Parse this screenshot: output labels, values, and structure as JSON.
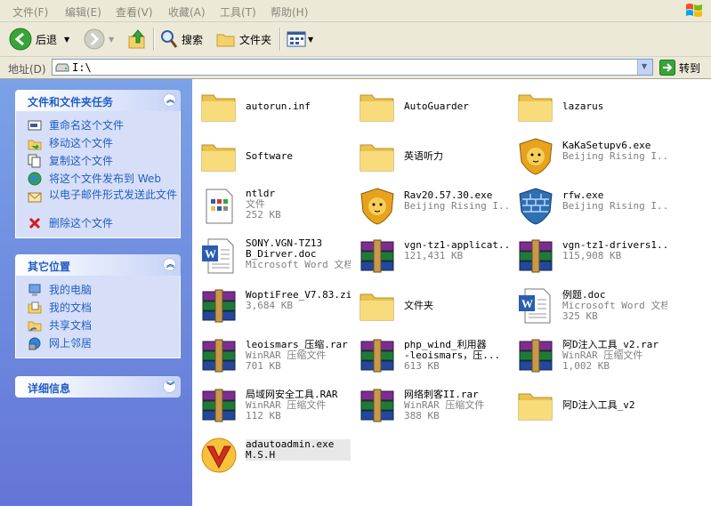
{
  "menu": [
    "文件(F)",
    "编辑(E)",
    "查看(V)",
    "收藏(A)",
    "工具(T)",
    "帮助(H)"
  ],
  "toolbar": {
    "back": "后退",
    "search": "搜索",
    "folders": "文件夹"
  },
  "address": {
    "label": "地址(D)",
    "path": "I:\\",
    "go": "转到"
  },
  "tasks": {
    "file_tasks": {
      "title": "文件和文件夹任务",
      "items": [
        "重命名这个文件",
        "移动这个文件",
        "复制这个文件",
        "将这个文件发布到 Web",
        "以电子邮件形式发送此文件",
        "删除这个文件"
      ]
    },
    "other_places": {
      "title": "其它位置",
      "items": [
        "我的电脑",
        "我的文档",
        "共享文档",
        "网上邻居"
      ]
    },
    "details": {
      "title": "详细信息"
    }
  },
  "files": [
    {
      "name": "autorun.inf",
      "l1": "",
      "l2": "",
      "icon": "folder"
    },
    {
      "name": "AutoGuarder",
      "l1": "",
      "l2": "",
      "icon": "folder"
    },
    {
      "name": "lazarus",
      "l1": "",
      "l2": "",
      "icon": "folder"
    },
    {
      "name": "Software",
      "l1": "",
      "l2": "",
      "icon": "folder"
    },
    {
      "name": "英语听力",
      "l1": "",
      "l2": "",
      "icon": "folder"
    },
    {
      "name": "KaKaSetupv6.exe",
      "l1": "Beijing Rising I...",
      "l2": "",
      "icon": "lion"
    },
    {
      "name": "ntldr",
      "l1": "文件",
      "l2": "252 KB",
      "icon": "sysfile"
    },
    {
      "name": "Rav20.57.30.exe",
      "l1": "Beijing Rising I...",
      "l2": "",
      "icon": "lion"
    },
    {
      "name": "rfw.exe",
      "l1": "Beijing Rising I...",
      "l2": "",
      "icon": "shield"
    },
    {
      "name": "SONY.VGN-TZ13",
      "name2": "B_Dirver.doc",
      "l1": "Microsoft Word 文档",
      "l2": "",
      "icon": "word"
    },
    {
      "name": "vgn-tz1-applicat...",
      "l1": "121,431 KB",
      "l2": "",
      "icon": "rar"
    },
    {
      "name": "vgn-tz1-drivers1...",
      "l1": "115,908 KB",
      "l2": "",
      "icon": "rar"
    },
    {
      "name": "WoptiFree_V7.83.zip",
      "l1": "3,684 KB",
      "l2": "",
      "icon": "rar"
    },
    {
      "name": "文件夹",
      "l1": "",
      "l2": "",
      "icon": "folder"
    },
    {
      "name": "例题.doc",
      "l1": "Microsoft Word 文档",
      "l2": "325 KB",
      "icon": "word"
    },
    {
      "name": "leoismars_压缩.rar",
      "l1": "WinRAR 压缩文件",
      "l2": "701 KB",
      "icon": "rar"
    },
    {
      "name": "php_wind_利用器",
      "name2": "-leoismars，压...",
      "l1": "613 KB",
      "l2": "",
      "icon": "rar"
    },
    {
      "name": "阿D注入工具_v2.rar",
      "l1": "WinRAR 压缩文件",
      "l2": "1,002 KB",
      "icon": "rar"
    },
    {
      "name": "局域网安全工具.RAR",
      "l1": "WinRAR 压缩文件",
      "l2": "112 KB",
      "icon": "rar"
    },
    {
      "name": "网络刺客II.rar",
      "l1": "WinRAR 压缩文件",
      "l2": "388 KB",
      "icon": "rar"
    },
    {
      "name": "阿D注入工具_v2",
      "l1": "",
      "l2": "",
      "icon": "folder"
    },
    {
      "name": "adautoadmin.exe",
      "l1": "M.S.H",
      "l2": "",
      "icon": "vlogo"
    }
  ]
}
